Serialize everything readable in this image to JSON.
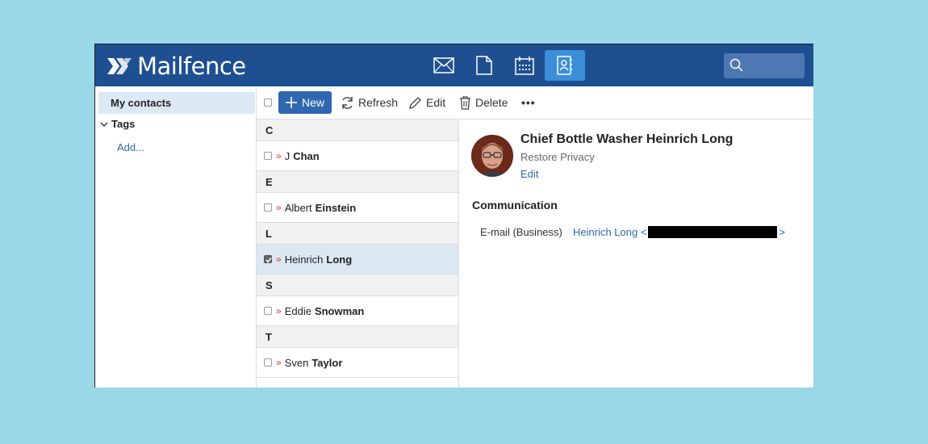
{
  "app": {
    "logo_text": "Mailfence",
    "nav_icons": [
      "mail-icon",
      "document-icon",
      "calendar-icon",
      "contacts-icon"
    ],
    "active_nav": "contacts-icon",
    "search": {
      "value": "",
      "icon": "search-icon"
    },
    "colors": {
      "header": "#1e4f91",
      "accent": "#2f67b0",
      "active_nav": "#3a8fd8",
      "selected_row": "#dbe7f3",
      "link": "#2a6ab0"
    }
  },
  "sidebar": {
    "my_contacts": "My contacts",
    "tags": "Tags",
    "add": "Add..."
  },
  "toolbar": {
    "new_label": "New",
    "refresh_label": "Refresh",
    "edit_label": "Edit",
    "delete_label": "Delete",
    "more_label": "•••"
  },
  "contacts": {
    "groups": [
      {
        "letter": "C",
        "items": [
          {
            "first": "J",
            "last": "Chan",
            "checked": false
          }
        ]
      },
      {
        "letter": "E",
        "items": [
          {
            "first": "Albert",
            "last": "Einstein",
            "checked": false
          }
        ]
      },
      {
        "letter": "L",
        "items": [
          {
            "first": "Heinrich",
            "last": "Long",
            "checked": true
          }
        ]
      },
      {
        "letter": "S",
        "items": [
          {
            "first": "Eddie",
            "last": "Snowman",
            "checked": false
          }
        ]
      },
      {
        "letter": "T",
        "items": [
          {
            "first": "Sven",
            "last": "Taylor",
            "checked": false
          }
        ]
      }
    ],
    "marker": "»"
  },
  "detail": {
    "name": "Chief Bottle Washer Heinrich Long",
    "company": "Restore Privacy",
    "edit_label": "Edit",
    "section_title": "Communication",
    "email_label": "E-mail (Business)",
    "email_name": "Heinrich Long <",
    "email_close": ">"
  }
}
